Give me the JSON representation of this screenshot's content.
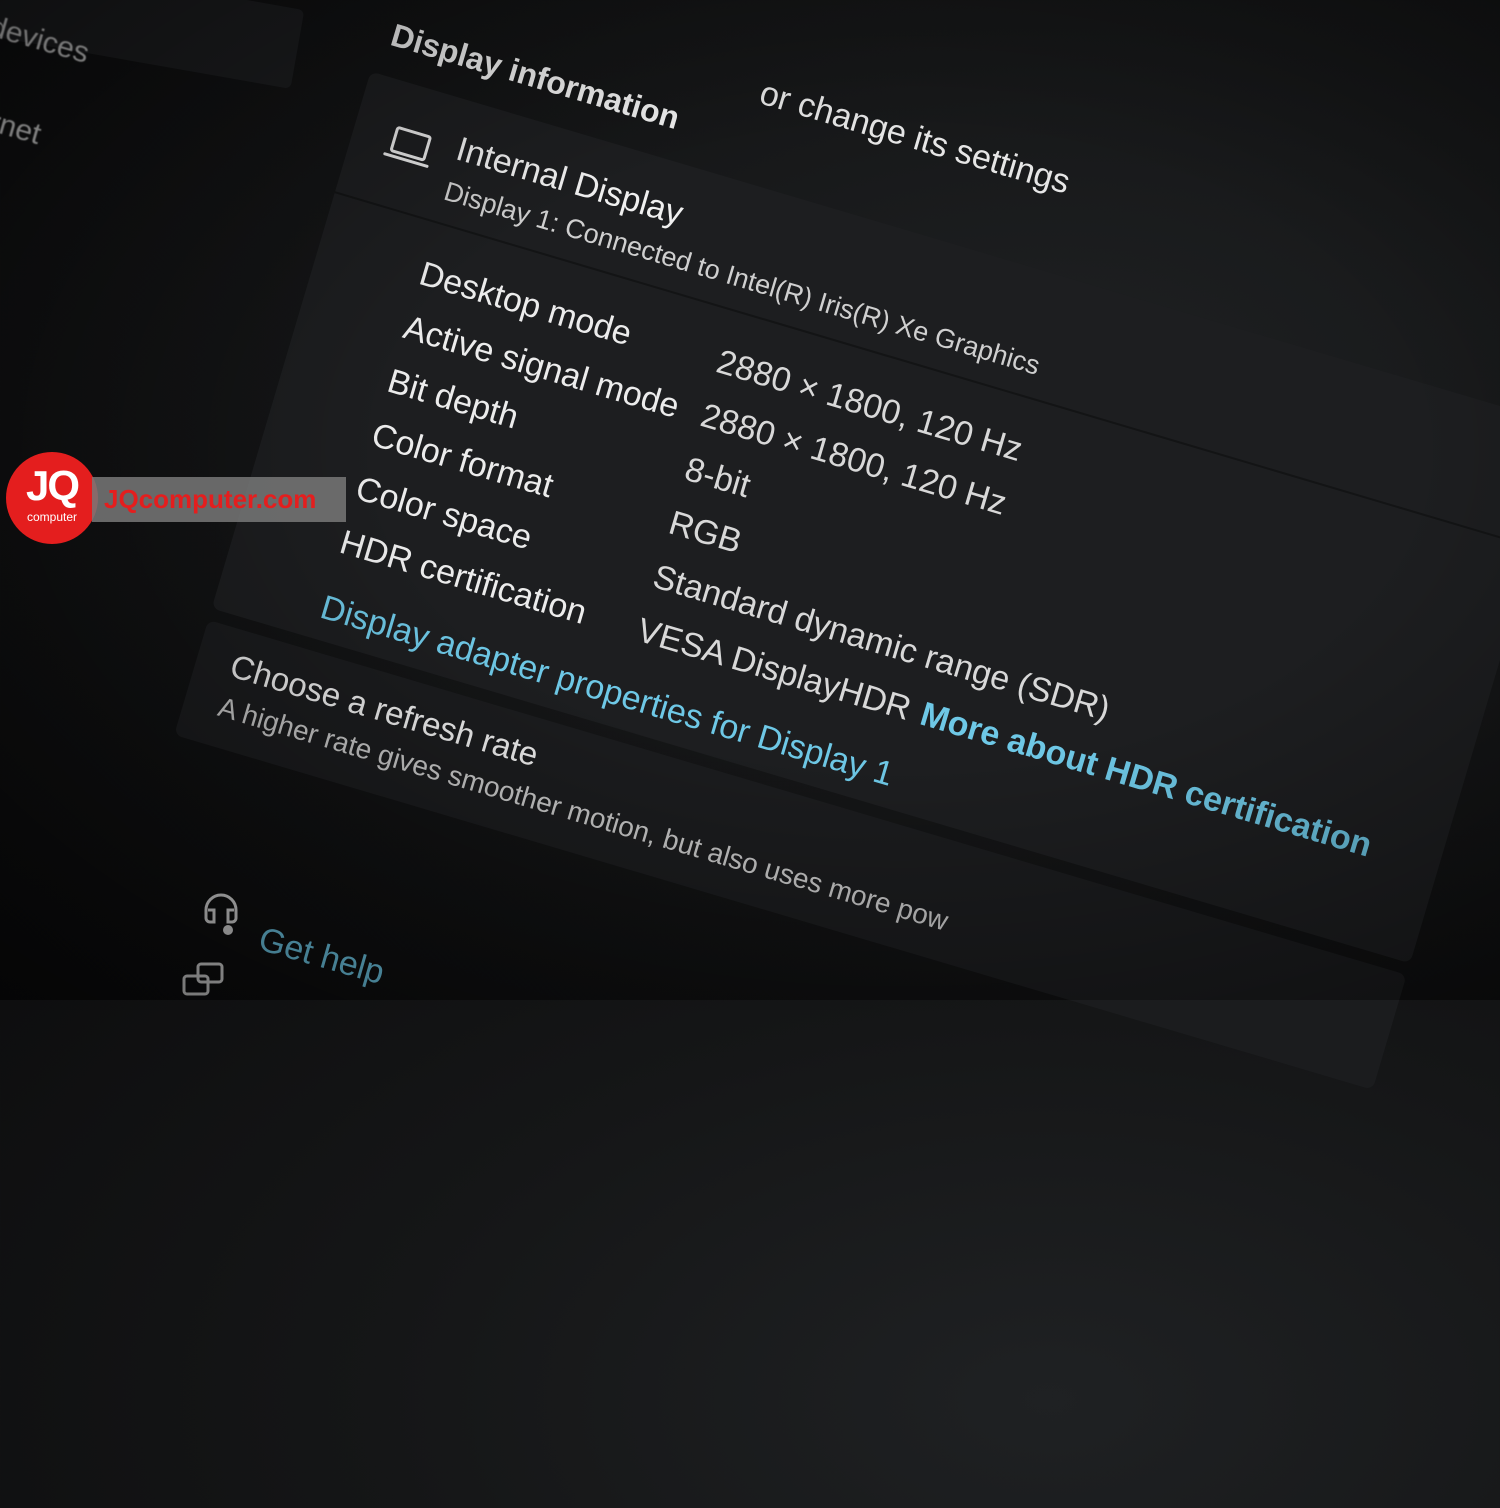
{
  "sidebar": {
    "items": [
      {
        "label": "devices"
      },
      {
        "label": "rnet"
      }
    ]
  },
  "header": {
    "partial_text": "or change its settings"
  },
  "display_information": {
    "section_title": "Display information",
    "display_name": "Internal Display",
    "display_subtitle": "Display 1: Connected to Intel(R) Iris(R) Xe Graphics",
    "rows": [
      {
        "label": "Desktop mode",
        "value": "2880 × 1800, 120 Hz"
      },
      {
        "label": "Active signal mode",
        "value": "2880 × 1800, 120 Hz"
      },
      {
        "label": "Bit depth",
        "value": "8-bit"
      },
      {
        "label": "Color format",
        "value": "RGB"
      },
      {
        "label": "Color space",
        "value": "Standard dynamic range (SDR)"
      },
      {
        "label": "HDR certification",
        "value": "VESA DisplayHDR",
        "link": "More about HDR certification"
      }
    ],
    "adapter_link": "Display adapter properties for Display 1"
  },
  "refresh_rate": {
    "title": "Choose a refresh rate",
    "description": "A higher rate gives smoother motion, but also uses more pow"
  },
  "help": {
    "get_help": "Get help"
  },
  "watermark": {
    "logo_main": "JQ",
    "logo_sub": "computer",
    "site": "JQcomputer.com"
  },
  "colors": {
    "background": "#151617",
    "card": "#1d1e20",
    "link": "#6ec8e6",
    "watermark_red": "#e41e1e"
  },
  "icons": [
    "laptop-icon",
    "help-icon",
    "feedback-icon"
  ]
}
